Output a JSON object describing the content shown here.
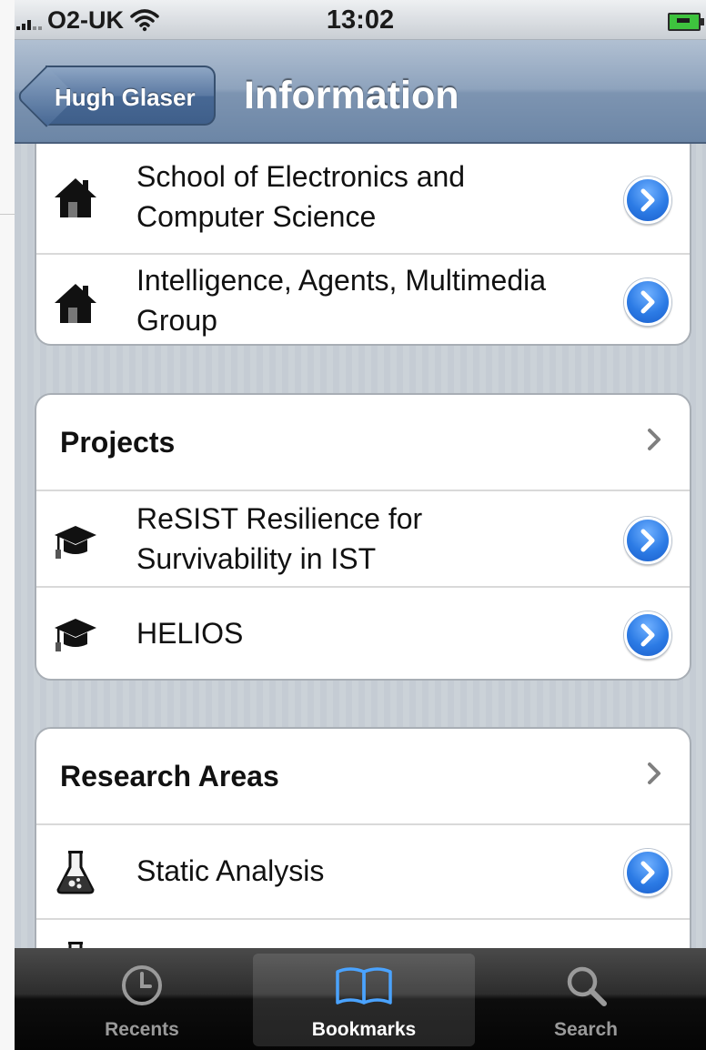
{
  "status_bar": {
    "carrier": "O2-UK",
    "time": "13:02"
  },
  "nav": {
    "back_label": "Hugh Glaser",
    "title": "Information"
  },
  "groups": [
    {
      "rows": [
        {
          "label": "School of Electronics and Computer Science",
          "lines": [
            "School of Electronics and",
            "Computer Science"
          ],
          "icon": "house-icon"
        },
        {
          "label": "Intelligence, Agents, Multimedia Group",
          "lines": [
            "Intelligence, Agents, Multimedia",
            "Group"
          ],
          "icon": "house-icon"
        }
      ]
    },
    {
      "header": "Projects",
      "rows": [
        {
          "lines": [
            "ReSIST Resilience for",
            "Survivability in IST"
          ],
          "icon": "graduation-cap-icon"
        },
        {
          "lines": [
            "HELIOS"
          ],
          "icon": "graduation-cap-icon"
        }
      ]
    },
    {
      "header": "Research Areas",
      "rows": [
        {
          "lines": [
            "Static Analysis"
          ],
          "icon": "flask-icon"
        }
      ]
    }
  ],
  "tab_bar": {
    "tabs": [
      {
        "label": "Recents",
        "icon": "clock-icon"
      },
      {
        "label": "Bookmarks",
        "icon": "book-icon",
        "selected": true
      },
      {
        "label": "Search",
        "icon": "magnifier-icon"
      }
    ]
  },
  "colors": {
    "nav_bar": "#7d94b1",
    "detail_button": "#2c7be5",
    "tab_bar": "#0d0d0d"
  }
}
